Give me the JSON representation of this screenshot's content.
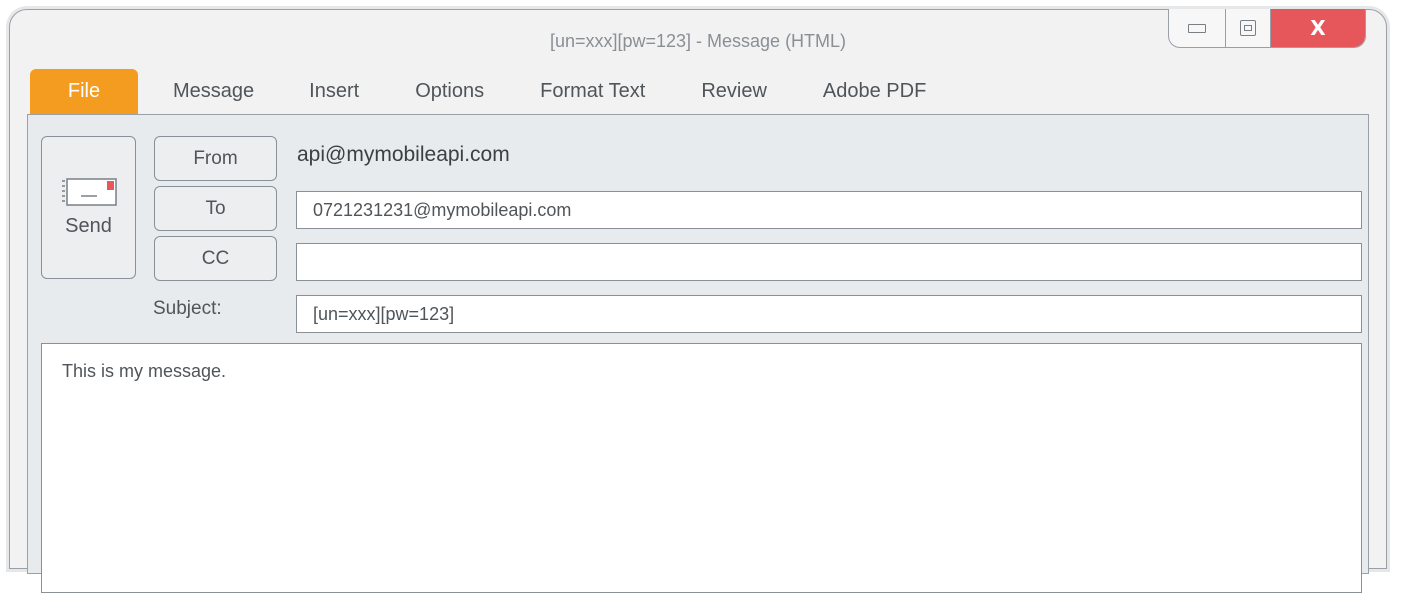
{
  "window": {
    "title": "[un=xxx][pw=123] - Message (HTML)",
    "close_label": "X"
  },
  "tabs": [
    {
      "label": "File",
      "active": true
    },
    {
      "label": "Message"
    },
    {
      "label": "Insert"
    },
    {
      "label": "Options"
    },
    {
      "label": "Format Text"
    },
    {
      "label": "Review"
    },
    {
      "label": "Adobe PDF"
    }
  ],
  "compose": {
    "send_label": "Send",
    "from_label": "From",
    "from_value": "api@mymobileapi.com",
    "to_label": "To",
    "to_value": "0721231231@mymobileapi.com",
    "cc_label": "CC",
    "cc_value": "",
    "subject_label": "Subject:",
    "subject_value": "[un=xxx][pw=123]",
    "body": "This is my message."
  },
  "colors": {
    "file_tab": "#f39c1f",
    "close_button": "#e5575b",
    "send_icon_flag": "#e5575b"
  },
  "icons": {
    "send": "envelope-icon",
    "minimize": "minimize-icon",
    "maximize": "maximize-icon",
    "close": "close-icon"
  }
}
